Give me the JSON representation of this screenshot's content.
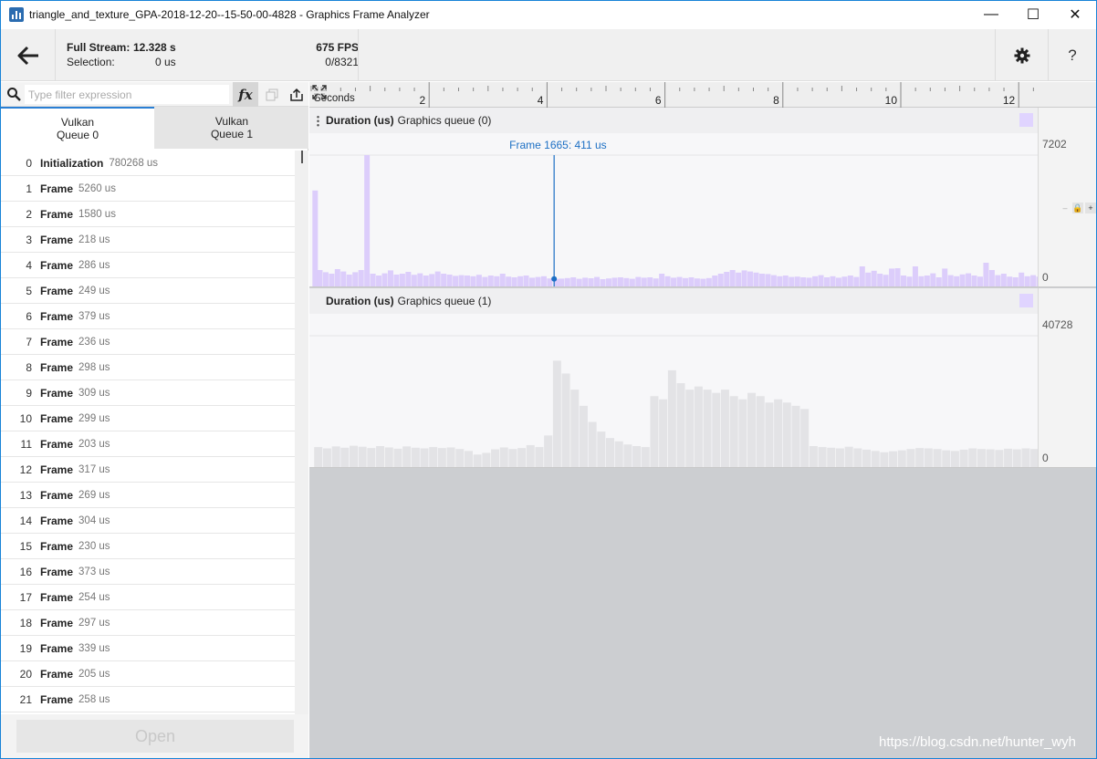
{
  "window": {
    "title": "triangle_and_texture_GPA-2018-12-20--15-50-00-4828 - Graphics Frame Analyzer",
    "minimize_icon": "minimize-icon",
    "maximize_icon": "maximize-icon",
    "close_icon": "close-icon",
    "minimize_glyph": "—",
    "maximize_glyph": "☐",
    "close_glyph": "✕"
  },
  "header": {
    "back_icon": "arrow-left-icon",
    "full_stream_label": "Full Stream:",
    "full_stream_value": "12.328 s",
    "fps": "675 FPS",
    "selection_label": "Selection:",
    "selection_value": "0 us",
    "selection_count": "0/8321",
    "settings_icon": "gear-icon",
    "help_label": "?"
  },
  "filter": {
    "placeholder": "Type filter expression",
    "value": "",
    "fx_label": "fx"
  },
  "tabs": [
    {
      "label": "Vulkan\nQueue 0",
      "active": true
    },
    {
      "label": "Vulkan\nQueue 1",
      "active": false
    }
  ],
  "list": [
    {
      "index": "0",
      "name": "Initialization",
      "duration": "780268 us"
    },
    {
      "index": "1",
      "name": "Frame",
      "duration": "5260 us"
    },
    {
      "index": "2",
      "name": "Frame",
      "duration": "1580 us"
    },
    {
      "index": "3",
      "name": "Frame",
      "duration": "218 us"
    },
    {
      "index": "4",
      "name": "Frame",
      "duration": "286 us"
    },
    {
      "index": "5",
      "name": "Frame",
      "duration": "249 us"
    },
    {
      "index": "6",
      "name": "Frame",
      "duration": "379 us"
    },
    {
      "index": "7",
      "name": "Frame",
      "duration": "236 us"
    },
    {
      "index": "8",
      "name": "Frame",
      "duration": "298 us"
    },
    {
      "index": "9",
      "name": "Frame",
      "duration": "309 us"
    },
    {
      "index": "10",
      "name": "Frame",
      "duration": "299 us"
    },
    {
      "index": "11",
      "name": "Frame",
      "duration": "203 us"
    },
    {
      "index": "12",
      "name": "Frame",
      "duration": "317 us"
    },
    {
      "index": "13",
      "name": "Frame",
      "duration": "269 us"
    },
    {
      "index": "14",
      "name": "Frame",
      "duration": "304 us"
    },
    {
      "index": "15",
      "name": "Frame",
      "duration": "230 us"
    },
    {
      "index": "16",
      "name": "Frame",
      "duration": "373 us"
    },
    {
      "index": "17",
      "name": "Frame",
      "duration": "254 us"
    },
    {
      "index": "18",
      "name": "Frame",
      "duration": "297 us"
    },
    {
      "index": "19",
      "name": "Frame",
      "duration": "339 us"
    },
    {
      "index": "20",
      "name": "Frame",
      "duration": "205 us"
    },
    {
      "index": "21",
      "name": "Frame",
      "duration": "258 us"
    }
  ],
  "open_button": "Open",
  "timeline": {
    "label": "Seconds",
    "ticks": [
      "2",
      "4",
      "6",
      "8",
      "10",
      "12"
    ],
    "max_seconds": 12.328
  },
  "panels": [
    {
      "metric": "Duration (us)",
      "queue": "Graphics queue (0)",
      "max": "7202",
      "min": "0",
      "marker_label": "Frame 1665: 411 us",
      "marker_time": 4.12,
      "swatch_color": "#e0d4ff",
      "bar_color": "#dccdfb",
      "marker_color": "#1c6fc4"
    },
    {
      "metric": "Duration (us)",
      "queue": "Graphics queue (1)",
      "max": "40728",
      "min": "0",
      "swatch_color": "#e0d4ff",
      "bar_color": "#e3e3e6"
    }
  ],
  "chart_data": [
    {
      "type": "bar",
      "title": "Duration (us) Graphics queue (0)",
      "xlabel": "Seconds",
      "ylabel": "Duration (us)",
      "xlim": [
        0,
        12.328
      ],
      "ylim": [
        0,
        7202
      ],
      "highlight": {
        "frame": 1665,
        "value": 411,
        "time": 4.12
      },
      "series": [
        {
          "x": [
            0.02,
            0.1,
            0.2,
            0.3,
            0.4,
            0.5,
            0.6,
            0.7,
            0.8,
            0.9,
            1.0,
            1.1,
            1.2,
            1.3,
            1.4,
            1.5,
            1.6,
            1.7,
            1.8,
            1.9,
            2.0,
            2.1,
            2.2,
            2.3,
            2.4,
            2.5,
            2.6,
            2.7,
            2.8,
            2.9,
            3.0,
            3.1,
            3.2,
            3.3,
            3.4,
            3.5,
            3.6,
            3.7,
            3.8,
            3.9,
            4.0,
            4.12,
            4.2,
            4.3,
            4.4,
            4.5,
            4.6,
            4.7,
            4.8,
            4.9,
            5.0,
            5.1,
            5.2,
            5.3,
            5.4,
            5.5,
            5.6,
            5.7,
            5.8,
            5.9,
            6.0,
            6.1,
            6.2,
            6.3,
            6.4,
            6.5,
            6.6,
            6.7,
            6.8,
            6.9,
            7.0,
            7.1,
            7.2,
            7.3,
            7.4,
            7.5,
            7.6,
            7.7,
            7.8,
            7.9,
            8.0,
            8.1,
            8.2,
            8.3,
            8.4,
            8.5,
            8.6,
            8.7,
            8.8,
            8.9,
            9.0,
            9.1,
            9.2,
            9.3,
            9.4,
            9.5,
            9.6,
            9.7,
            9.8,
            9.9,
            10.0,
            10.1,
            10.2,
            10.3,
            10.4,
            10.5,
            10.6,
            10.7,
            10.8,
            10.9,
            11.0,
            11.1,
            11.2,
            11.3,
            11.4,
            11.5,
            11.6,
            11.7,
            11.8,
            11.9,
            12.0,
            12.1,
            12.2,
            12.3
          ],
          "values": [
            5260,
            900,
            780,
            700,
            950,
            820,
            650,
            780,
            900,
            7202,
            700,
            600,
            720,
            880,
            650,
            700,
            800,
            640,
            720,
            600,
            680,
            820,
            700,
            650,
            580,
            620,
            600,
            560,
            640,
            520,
            600,
            560,
            700,
            540,
            500,
            560,
            600,
            480,
            520,
            560,
            440,
            411,
            430,
            460,
            500,
            420,
            480,
            450,
            520,
            400,
            440,
            480,
            500,
            460,
            420,
            520,
            480,
            500,
            440,
            700,
            560,
            480,
            520,
            460,
            500,
            440,
            420,
            460,
            600,
            700,
            800,
            900,
            760,
            880,
            820,
            760,
            700,
            680,
            620,
            560,
            600,
            520,
            540,
            500,
            480,
            560,
            620,
            500,
            560,
            480,
            540,
            600,
            520,
            1100,
            760,
            860,
            700,
            640,
            980,
            1000,
            600,
            540,
            1100,
            560,
            600,
            720,
            500,
            980,
            620,
            560,
            660,
            720,
            600,
            540,
            1300,
            900,
            620,
            700,
            540,
            500,
            760,
            560,
            620,
            540
          ]
        }
      ]
    },
    {
      "type": "bar",
      "title": "Duration (us) Graphics queue (1)",
      "xlabel": "Seconds",
      "ylabel": "Duration (us)",
      "xlim": [
        0,
        12.328
      ],
      "ylim": [
        0,
        40728
      ],
      "series": [
        {
          "x": [
            0.05,
            0.2,
            0.35,
            0.5,
            0.65,
            0.8,
            0.95,
            1.1,
            1.25,
            1.4,
            1.55,
            1.7,
            1.85,
            2.0,
            2.15,
            2.3,
            2.45,
            2.6,
            2.75,
            2.9,
            3.05,
            3.2,
            3.35,
            3.5,
            3.65,
            3.8,
            3.95,
            4.1,
            4.25,
            4.4,
            4.55,
            4.7,
            4.85,
            5.0,
            5.15,
            5.3,
            5.45,
            5.6,
            5.75,
            5.9,
            6.05,
            6.2,
            6.35,
            6.5,
            6.65,
            6.8,
            6.95,
            7.1,
            7.25,
            7.4,
            7.55,
            7.7,
            7.85,
            8.0,
            8.15,
            8.3,
            8.45,
            8.6,
            8.75,
            8.9,
            9.05,
            9.2,
            9.35,
            9.5,
            9.65,
            9.8,
            9.95,
            10.1,
            10.25,
            10.4,
            10.55,
            10.7,
            10.85,
            11.0,
            11.15,
            11.3,
            11.45,
            11.6,
            11.75,
            11.9,
            12.05,
            12.2
          ],
          "values": [
            6200,
            5800,
            6400,
            6000,
            6600,
            6300,
            5900,
            6500,
            6100,
            5700,
            6400,
            6000,
            5800,
            6200,
            5900,
            6100,
            5600,
            5000,
            3900,
            4400,
            5500,
            6100,
            5600,
            5900,
            6800,
            6200,
            9800,
            33000,
            29000,
            24000,
            19000,
            14000,
            11000,
            9000,
            8000,
            7000,
            6500,
            6200,
            22000,
            21000,
            30000,
            26000,
            24000,
            25000,
            24000,
            23000,
            24000,
            22000,
            21000,
            23000,
            22000,
            20000,
            21000,
            20000,
            19000,
            18000,
            6500,
            6200,
            6000,
            5800,
            6300,
            5800,
            5400,
            5000,
            4600,
            4900,
            5200,
            5600,
            5900,
            5800,
            5600,
            5200,
            5000,
            5400,
            5800,
            5600,
            5500,
            5300,
            5700,
            5500,
            5800,
            5600
          ]
        }
      ]
    }
  ],
  "watermark": "https://blog.csdn.net/hunter_wyh"
}
